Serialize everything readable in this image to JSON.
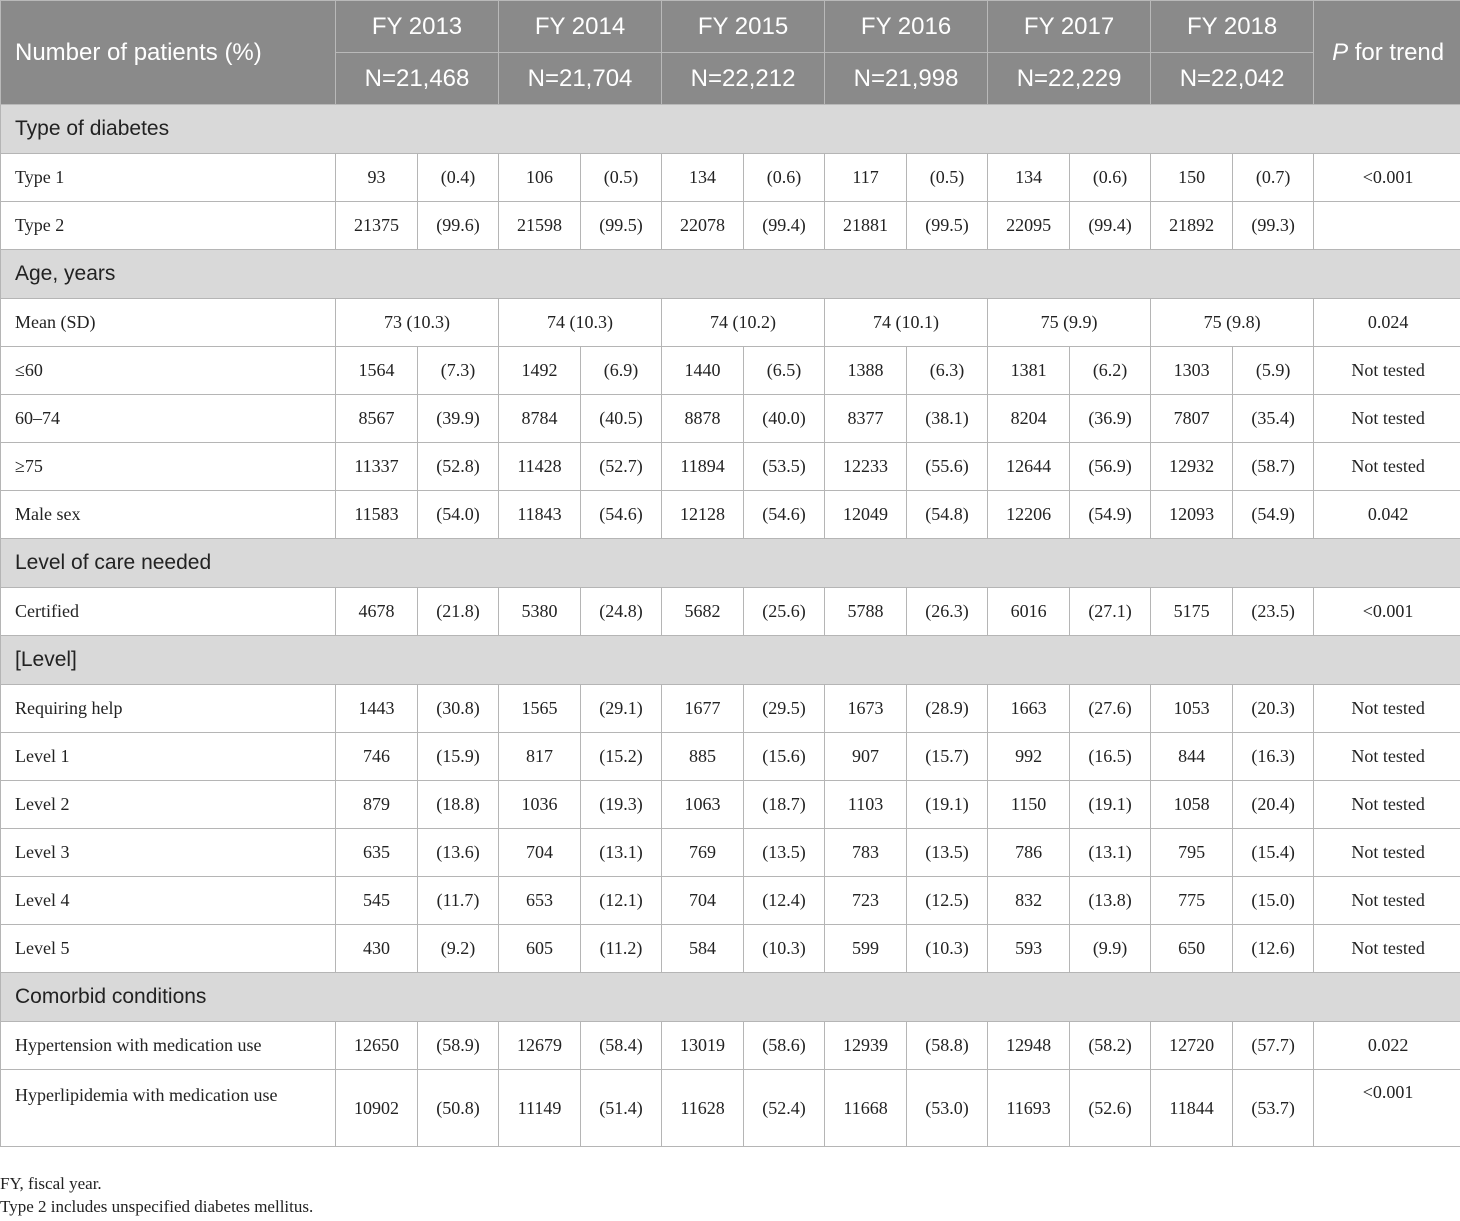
{
  "header": {
    "corner_label": "Number of patients (%)",
    "ptrend_italic": "P",
    "ptrend_rest": " for trend",
    "years": [
      {
        "fy": "FY 2013",
        "n": "N=21,468"
      },
      {
        "fy": "FY 2014",
        "n": "N=21,704"
      },
      {
        "fy": "FY 2015",
        "n": "N=22,212"
      },
      {
        "fy": "FY 2016",
        "n": "N=21,998"
      },
      {
        "fy": "FY 2017",
        "n": "N=22,229"
      },
      {
        "fy": "FY 2018",
        "n": "N=22,042"
      }
    ]
  },
  "sections": {
    "diabetes": {
      "title": "Type of diabetes",
      "rows": [
        {
          "label": "Type 1",
          "cells": [
            [
              "93",
              "(0.4)"
            ],
            [
              "106",
              "(0.5)"
            ],
            [
              "134",
              "(0.6)"
            ],
            [
              "117",
              "(0.5)"
            ],
            [
              "134",
              "(0.6)"
            ],
            [
              "150",
              "(0.7)"
            ]
          ],
          "p": "<0.001"
        },
        {
          "label": "Type 2",
          "cells": [
            [
              "21375",
              "(99.6)"
            ],
            [
              "21598",
              "(99.5)"
            ],
            [
              "22078",
              "(99.4)"
            ],
            [
              "21881",
              "(99.5)"
            ],
            [
              "22095",
              "(99.4)"
            ],
            [
              "21892",
              "(99.3)"
            ]
          ],
          "p": ""
        }
      ]
    },
    "age": {
      "title": "Age, years",
      "mean_row": {
        "label": "Mean (SD)",
        "values": [
          "73 (10.3)",
          "74 (10.3)",
          "74 (10.2)",
          "74 (10.1)",
          "75 (9.9)",
          "75 (9.8)"
        ],
        "p": "0.024"
      },
      "rows": [
        {
          "label": "≤60",
          "cells": [
            [
              "1564",
              "(7.3)"
            ],
            [
              "1492",
              "(6.9)"
            ],
            [
              "1440",
              "(6.5)"
            ],
            [
              "1388",
              "(6.3)"
            ],
            [
              "1381",
              "(6.2)"
            ],
            [
              "1303",
              "(5.9)"
            ]
          ],
          "p": "Not tested"
        },
        {
          "label": "60–74",
          "cells": [
            [
              "8567",
              "(39.9)"
            ],
            [
              "8784",
              "(40.5)"
            ],
            [
              "8878",
              "(40.0)"
            ],
            [
              "8377",
              "(38.1)"
            ],
            [
              "8204",
              "(36.9)"
            ],
            [
              "7807",
              "(35.4)"
            ]
          ],
          "p": "Not tested"
        },
        {
          "label": "≥75",
          "cells": [
            [
              "11337",
              "(52.8)"
            ],
            [
              "11428",
              "(52.7)"
            ],
            [
              "11894",
              "(53.5)"
            ],
            [
              "12233",
              "(55.6)"
            ],
            [
              "12644",
              "(56.9)"
            ],
            [
              "12932",
              "(58.7)"
            ]
          ],
          "p": "Not tested"
        },
        {
          "label": "Male sex",
          "cells": [
            [
              "11583",
              "(54.0)"
            ],
            [
              "11843",
              "(54.6)"
            ],
            [
              "12128",
              "(54.6)"
            ],
            [
              "12049",
              "(54.8)"
            ],
            [
              "12206",
              "(54.9)"
            ],
            [
              "12093",
              "(54.9)"
            ]
          ],
          "p": "0.042"
        }
      ]
    },
    "care": {
      "title": "Level of care needed",
      "rows": [
        {
          "label": "Certified",
          "cells": [
            [
              "4678",
              "(21.8)"
            ],
            [
              "5380",
              "(24.8)"
            ],
            [
              "5682",
              "(25.6)"
            ],
            [
              "5788",
              "(26.3)"
            ],
            [
              "6016",
              "(27.1)"
            ],
            [
              "5175",
              "(23.5)"
            ]
          ],
          "p": "<0.001"
        }
      ]
    },
    "level": {
      "title": "[Level]",
      "rows": [
        {
          "label": "Requiring help",
          "cells": [
            [
              "1443",
              "(30.8)"
            ],
            [
              "1565",
              "(29.1)"
            ],
            [
              "1677",
              "(29.5)"
            ],
            [
              "1673",
              "(28.9)"
            ],
            [
              "1663",
              "(27.6)"
            ],
            [
              "1053",
              "(20.3)"
            ]
          ],
          "p": "Not tested"
        },
        {
          "label": "Level 1",
          "cells": [
            [
              "746",
              "(15.9)"
            ],
            [
              "817",
              "(15.2)"
            ],
            [
              "885",
              "(15.6)"
            ],
            [
              "907",
              "(15.7)"
            ],
            [
              "992",
              "(16.5)"
            ],
            [
              "844",
              "(16.3)"
            ]
          ],
          "p": "Not tested"
        },
        {
          "label": "Level 2",
          "cells": [
            [
              "879",
              "(18.8)"
            ],
            [
              "1036",
              "(19.3)"
            ],
            [
              "1063",
              "(18.7)"
            ],
            [
              "1103",
              "(19.1)"
            ],
            [
              "1150",
              "(19.1)"
            ],
            [
              "1058",
              "(20.4)"
            ]
          ],
          "p": "Not tested"
        },
        {
          "label": "Level 3",
          "cells": [
            [
              "635",
              "(13.6)"
            ],
            [
              "704",
              "(13.1)"
            ],
            [
              "769",
              "(13.5)"
            ],
            [
              "783",
              "(13.5)"
            ],
            [
              "786",
              "(13.1)"
            ],
            [
              "795",
              "(15.4)"
            ]
          ],
          "p": "Not tested"
        },
        {
          "label": "Level 4",
          "cells": [
            [
              "545",
              "(11.7)"
            ],
            [
              "653",
              "(12.1)"
            ],
            [
              "704",
              "(12.4)"
            ],
            [
              "723",
              "(12.5)"
            ],
            [
              "832",
              "(13.8)"
            ],
            [
              "775",
              "(15.0)"
            ]
          ],
          "p": "Not tested"
        },
        {
          "label": "Level 5",
          "cells": [
            [
              "430",
              "(9.2)"
            ],
            [
              "605",
              "(11.2)"
            ],
            [
              "584",
              "(10.3)"
            ],
            [
              "599",
              "(10.3)"
            ],
            [
              "593",
              "(9.9)"
            ],
            [
              "650",
              "(12.6)"
            ]
          ],
          "p": "Not tested"
        }
      ]
    },
    "comorbid": {
      "title": "Comorbid conditions",
      "rows": [
        {
          "label": "Hypertension with medication use",
          "cells": [
            [
              "12650",
              "(58.9)"
            ],
            [
              "12679",
              "(58.4)"
            ],
            [
              "13019",
              "(58.6)"
            ],
            [
              "12939",
              "(58.8)"
            ],
            [
              "12948",
              "(58.2)"
            ],
            [
              "12720",
              "(57.7)"
            ]
          ],
          "p": "0.022"
        },
        {
          "label": "Hyperlipidemia with medication use",
          "cells": [
            [
              "10902",
              "(50.8)"
            ],
            [
              "11149",
              "(51.4)"
            ],
            [
              "11628",
              "(52.4)"
            ],
            [
              "11668",
              "(53.0)"
            ],
            [
              "11693",
              "(52.6)"
            ],
            [
              "11844",
              "(53.7)"
            ]
          ],
          "p": "<0.001"
        }
      ]
    }
  },
  "footnotes": [
    "FY, fiscal year.",
    "Type 2 includes unspecified diabetes mellitus."
  ]
}
